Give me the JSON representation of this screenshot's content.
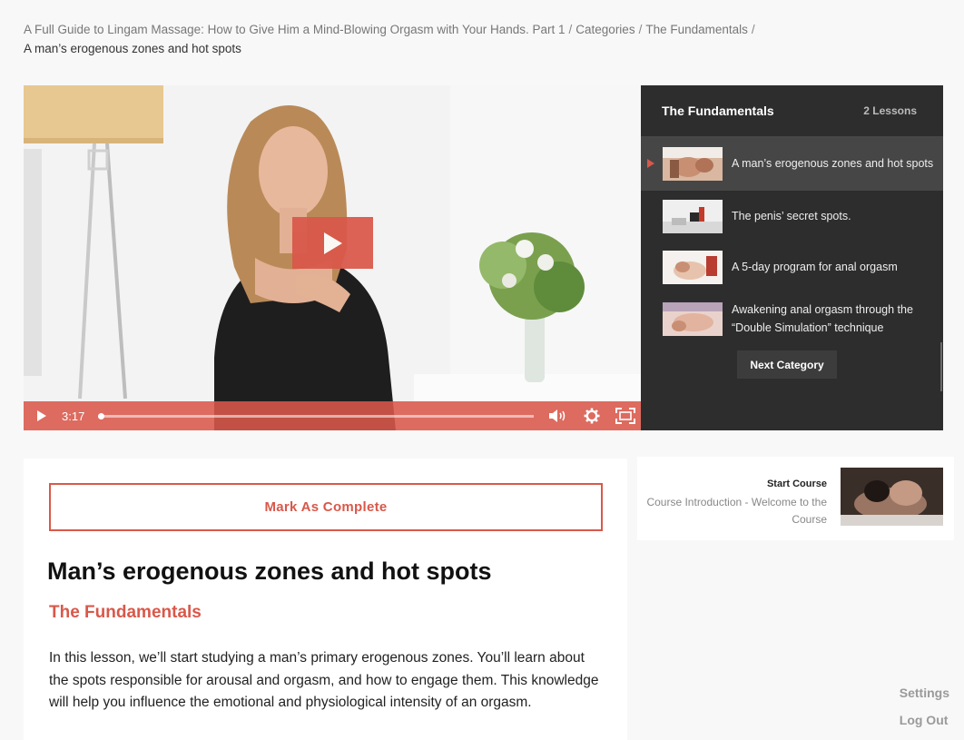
{
  "breadcrumb": {
    "course": "A Full Guide to Lingam Massage: How to Give Him a Mind-Blowing Orgasm with Your Hands. Part 1",
    "categories": "Categories",
    "category": "The Fundamentals",
    "separator": "/",
    "current": "A man’s erogenous zones and hot spots"
  },
  "player": {
    "time": "3:17",
    "progress_fraction": 0.0,
    "accent_color": "#d9584a"
  },
  "playlist": {
    "title": "The Fundamentals",
    "count": "2 Lessons",
    "items": [
      {
        "label": "A man’s erogenous zones and hot spots",
        "active": true
      },
      {
        "label": "The penis’ secret spots.",
        "active": false
      },
      {
        "label": "A 5-day program for anal orgasm",
        "active": false
      },
      {
        "label": "Awakening anal orgasm through the “Double Simulation” technique",
        "active": false
      }
    ],
    "next_button": "Next Category"
  },
  "lesson": {
    "mark_complete": "Mark As Complete",
    "title": "Man’s erogenous zones and hot spots",
    "category": "The Fundamentals",
    "description": "In this lesson, we’ll start studying a man’s primary erogenous zones. You’ll learn about the spots responsible for arousal and orgasm, and how to engage them. This knowledge will help you influence the emotional and physiological intensity of an orgasm."
  },
  "start_course": {
    "label": "Start Course",
    "subtitle": "Course Introduction - Welcome to the Course"
  },
  "side_links": {
    "settings": "Settings",
    "logout": "Log Out"
  },
  "icons": [
    "play-icon",
    "volume-icon",
    "gear-icon",
    "fullscreen-icon",
    "current-arrow-icon"
  ]
}
